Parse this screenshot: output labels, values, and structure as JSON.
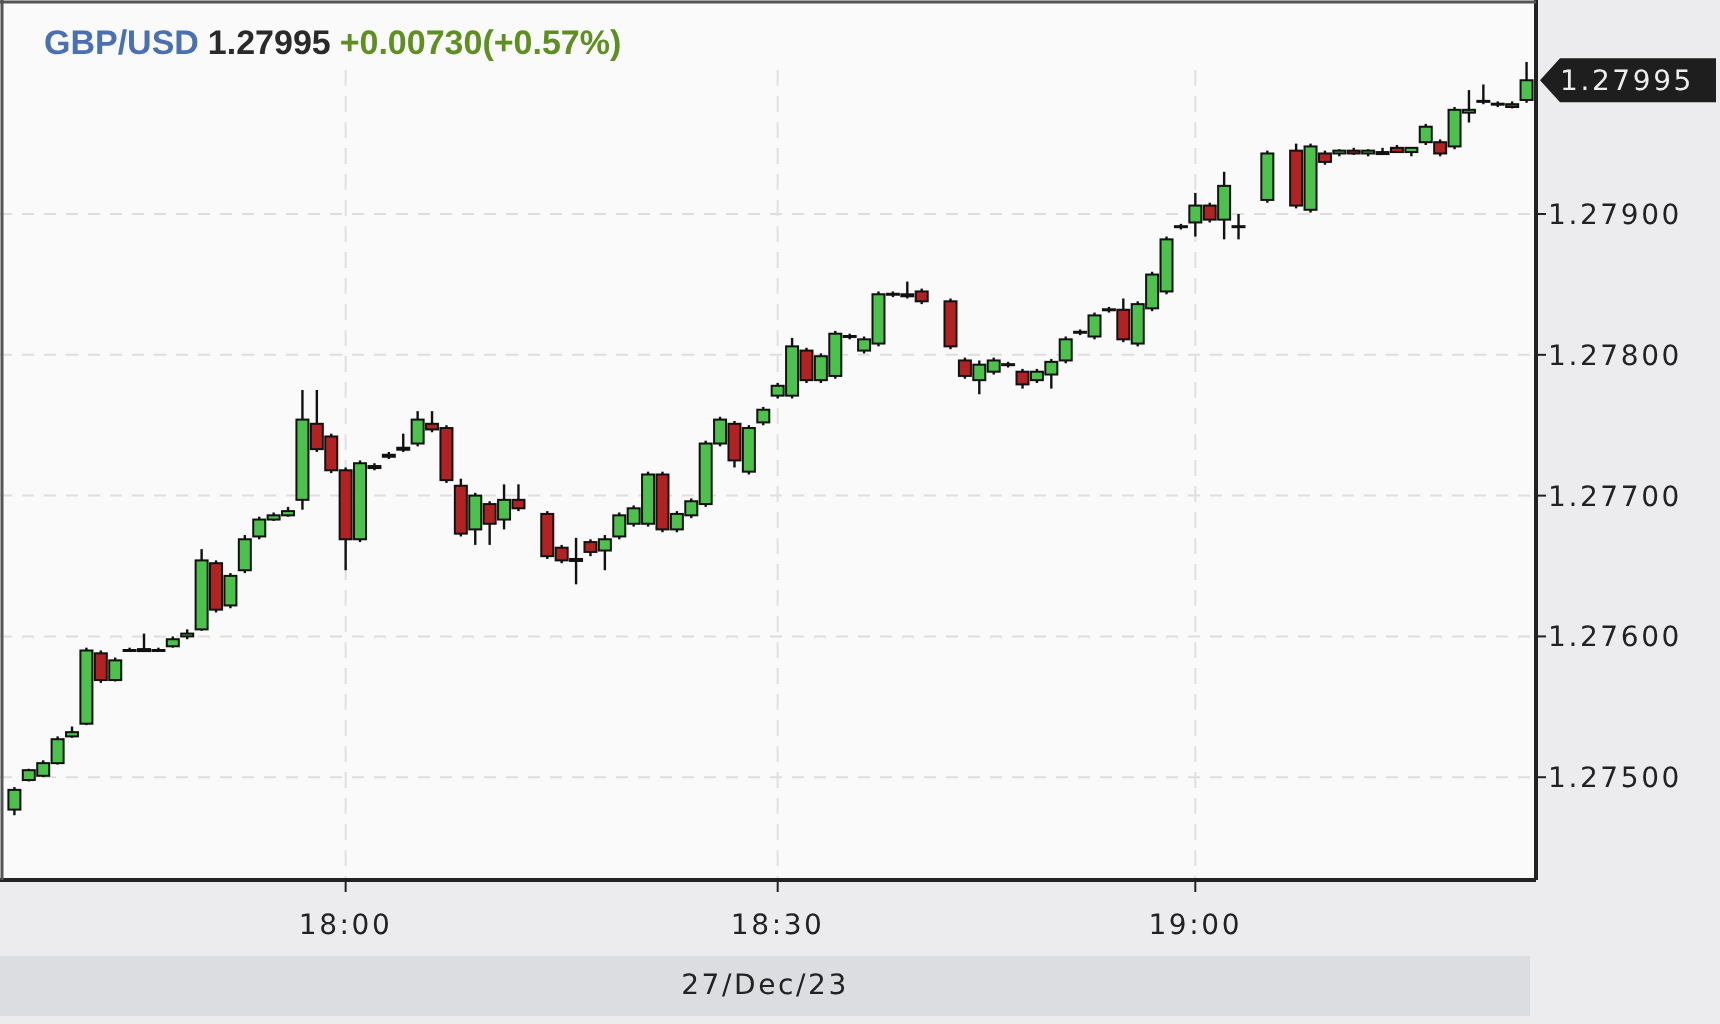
{
  "header": {
    "symbol": "GBP/USD",
    "price": "1.27995",
    "change": "+0.00730(+0.57%)"
  },
  "last_price_tag": "1.27995",
  "date_label": "27/Dec/23",
  "chart_data": {
    "type": "candlestick",
    "grid": true,
    "ylim": [
      1.27427,
      1.28052
    ],
    "yticks": [
      {
        "value": 1.279,
        "label": "1.27900"
      },
      {
        "value": 1.278,
        "label": "1.27800"
      },
      {
        "value": 1.277,
        "label": "1.27700"
      },
      {
        "value": 1.276,
        "label": "1.27600"
      },
      {
        "value": 1.275,
        "label": "1.27500"
      }
    ],
    "categories": [
      null,
      null,
      null,
      null,
      null,
      null,
      null,
      null,
      null,
      null,
      null,
      null,
      null,
      null,
      null,
      null,
      null,
      null,
      null,
      null,
      null,
      null,
      null,
      "18:00",
      null,
      null,
      null,
      null,
      null,
      null,
      null,
      null,
      null,
      null,
      null,
      null,
      null,
      null,
      null,
      null,
      null,
      null,
      null,
      null,
      null,
      null,
      null,
      null,
      null,
      null,
      null,
      null,
      null,
      "18:30",
      null,
      null,
      null,
      null,
      null,
      null,
      null,
      null,
      null,
      null,
      null,
      null,
      null,
      null,
      null,
      null,
      null,
      null,
      null,
      null,
      null,
      null,
      null,
      null,
      null,
      null,
      null,
      null,
      "19:00",
      null,
      null,
      null,
      null,
      null,
      null,
      null,
      null,
      null,
      null,
      null,
      null,
      null,
      null,
      null,
      null,
      null,
      null,
      null,
      null,
      null,
      null,
      null
    ],
    "ohlc": [
      [
        1.27477,
        1.27493,
        1.27473,
        1.27491
      ],
      [
        1.27498,
        1.27506,
        1.27497,
        1.27505
      ],
      [
        1.27501,
        1.27512,
        1.275,
        1.2751
      ],
      [
        1.2751,
        1.27529,
        1.27509,
        1.27527
      ],
      [
        1.27529,
        1.27536,
        1.27528,
        1.27532
      ],
      [
        1.27538,
        1.27592,
        1.27537,
        1.2759
      ],
      [
        1.27588,
        1.2759,
        1.27567,
        1.27569
      ],
      [
        1.27569,
        1.27585,
        1.27568,
        1.27583
      ],
      [
        1.2759,
        1.27592,
        1.27589,
        1.2759
      ],
      [
        1.2759,
        1.27602,
        1.27589,
        1.27591
      ],
      [
        1.2759,
        1.27592,
        1.27589,
        1.2759
      ],
      [
        1.27593,
        1.276,
        1.27592,
        1.27598
      ],
      [
        1.276,
        1.27605,
        1.27598,
        1.27602
      ],
      [
        1.27605,
        1.27662,
        1.27604,
        1.27654
      ],
      [
        1.27652,
        1.27654,
        1.27617,
        1.27619
      ],
      [
        1.27622,
        1.27645,
        1.2762,
        1.27643
      ],
      [
        1.27647,
        1.27672,
        1.27645,
        1.27669
      ],
      [
        1.27671,
        1.27685,
        1.27669,
        1.27683
      ],
      [
        1.27683,
        1.27688,
        1.27682,
        1.27686
      ],
      [
        1.27686,
        1.27692,
        1.27685,
        1.27689
      ],
      [
        1.27697,
        1.27775,
        1.2769,
        1.27754
      ],
      [
        1.27751,
        1.27775,
        1.27731,
        1.27733
      ],
      [
        1.27742,
        1.27744,
        1.27716,
        1.27718
      ],
      [
        1.27718,
        1.2772,
        1.27647,
        1.27669
      ],
      [
        1.27669,
        1.27725,
        1.27667,
        1.27723
      ],
      [
        1.27721,
        1.27723,
        1.27718,
        1.2772
      ],
      [
        1.27728,
        1.27731,
        1.27726,
        1.27729
      ],
      [
        1.27733,
        1.27744,
        1.27731,
        1.27734
      ],
      [
        1.27737,
        1.2776,
        1.27735,
        1.27754
      ],
      [
        1.27751,
        1.2776,
        1.27745,
        1.27747
      ],
      [
        1.27748,
        1.2775,
        1.27709,
        1.27711
      ],
      [
        1.27707,
        1.27712,
        1.27671,
        1.27673
      ],
      [
        1.27676,
        1.27702,
        1.27665,
        1.277
      ],
      [
        1.27694,
        1.27696,
        1.27665,
        1.2768
      ],
      [
        1.27683,
        1.27708,
        1.27676,
        1.27697
      ],
      [
        1.27697,
        1.27708,
        1.27689,
        1.27691
      ],
      null,
      [
        1.27687,
        1.27689,
        1.27655,
        1.27657
      ],
      [
        1.27663,
        1.27665,
        1.27652,
        1.27654
      ],
      [
        1.27654,
        1.2767,
        1.27637,
        1.27655
      ],
      [
        1.27667,
        1.27669,
        1.27657,
        1.2766
      ],
      [
        1.27661,
        1.27672,
        1.27647,
        1.27669
      ],
      [
        1.27671,
        1.27688,
        1.27669,
        1.27686
      ],
      [
        1.2768,
        1.27693,
        1.27678,
        1.27691
      ],
      [
        1.2768,
        1.27717,
        1.27678,
        1.27715
      ],
      [
        1.27715,
        1.27717,
        1.27674,
        1.27676
      ],
      [
        1.27676,
        1.27689,
        1.27674,
        1.27687
      ],
      [
        1.27686,
        1.27698,
        1.27684,
        1.27696
      ],
      [
        1.27694,
        1.27739,
        1.27692,
        1.27737
      ],
      [
        1.27737,
        1.27756,
        1.27735,
        1.27754
      ],
      [
        1.27751,
        1.27753,
        1.2772,
        1.27725
      ],
      [
        1.27717,
        1.2775,
        1.27715,
        1.27748
      ],
      [
        1.27752,
        1.27763,
        1.2775,
        1.27761
      ],
      [
        1.27771,
        1.2778,
        1.27769,
        1.27778
      ],
      [
        1.27771,
        1.27812,
        1.27769,
        1.27806
      ],
      [
        1.27803,
        1.27805,
        1.2778,
        1.27782
      ],
      [
        1.27782,
        1.27801,
        1.2778,
        1.27799
      ],
      [
        1.27785,
        1.27817,
        1.27783,
        1.27815
      ],
      [
        1.27813,
        1.27815,
        1.27811,
        1.27813
      ],
      [
        1.27803,
        1.27813,
        1.27801,
        1.27811
      ],
      [
        1.27808,
        1.27845,
        1.27806,
        1.27843
      ],
      [
        1.27843,
        1.27845,
        1.27841,
        1.27843
      ],
      [
        1.27842,
        1.27852,
        1.2784,
        1.27843
      ],
      [
        1.27845,
        1.27847,
        1.27836,
        1.27838
      ],
      null,
      [
        1.27838,
        1.2784,
        1.27804,
        1.27806
      ],
      [
        1.27796,
        1.27798,
        1.27783,
        1.27785
      ],
      [
        1.27782,
        1.27796,
        1.27772,
        1.27793
      ],
      [
        1.27788,
        1.27798,
        1.27786,
        1.27796
      ],
      [
        1.27793,
        1.27795,
        1.27791,
        1.27793
      ],
      [
        1.27788,
        1.2779,
        1.27776,
        1.27779
      ],
      [
        1.27782,
        1.2779,
        1.2778,
        1.27788
      ],
      [
        1.27786,
        1.27797,
        1.27776,
        1.27795
      ],
      [
        1.27796,
        1.27813,
        1.27794,
        1.27811
      ],
      [
        1.27816,
        1.27818,
        1.27814,
        1.27816
      ],
      [
        1.27813,
        1.2783,
        1.27811,
        1.27828
      ],
      [
        1.27832,
        1.27834,
        1.2783,
        1.27832
      ],
      [
        1.27832,
        1.2784,
        1.27809,
        1.27811
      ],
      [
        1.27808,
        1.27838,
        1.27806,
        1.27836
      ],
      [
        1.27833,
        1.27859,
        1.27831,
        1.27857
      ],
      [
        1.27845,
        1.27884,
        1.27843,
        1.27882
      ],
      [
        1.27891,
        1.27893,
        1.27889,
        1.27891
      ],
      [
        1.27894,
        1.27915,
        1.27884,
        1.27906
      ],
      [
        1.27906,
        1.27908,
        1.27894,
        1.27896
      ],
      [
        1.27896,
        1.2793,
        1.27882,
        1.2792
      ],
      [
        1.27891,
        1.279,
        1.27882,
        1.27891
      ],
      null,
      [
        1.2791,
        1.27945,
        1.27908,
        1.27943
      ],
      null,
      [
        1.27945,
        1.2795,
        1.27904,
        1.27906
      ],
      [
        1.27903,
        1.2795,
        1.27901,
        1.27948
      ],
      [
        1.27943,
        1.27945,
        1.27935,
        1.27937
      ],
      [
        1.27943,
        1.27946,
        1.27941,
        1.27945
      ],
      [
        1.27945,
        1.27947,
        1.27942,
        1.27943
      ],
      [
        1.27943,
        1.27946,
        1.27941,
        1.27945
      ],
      [
        1.27944,
        1.27947,
        1.27942,
        1.27943
      ],
      [
        1.27947,
        1.27949,
        1.27944,
        1.27944
      ],
      [
        1.27944,
        1.27947,
        1.27941,
        1.27947
      ],
      [
        1.27951,
        1.27964,
        1.27949,
        1.27962
      ],
      [
        1.27951,
        1.27953,
        1.27941,
        1.27943
      ],
      [
        1.27948,
        1.27976,
        1.27946,
        1.27974
      ],
      [
        1.27972,
        1.27988,
        1.27965,
        1.27974
      ],
      [
        1.2798,
        1.27992,
        1.27978,
        1.2798
      ],
      [
        1.27978,
        1.2798,
        1.27976,
        1.27978
      ],
      [
        1.27978,
        1.2798,
        1.27975,
        1.27976
      ],
      [
        1.27981,
        1.28008,
        1.27979,
        1.27995
      ]
    ]
  }
}
